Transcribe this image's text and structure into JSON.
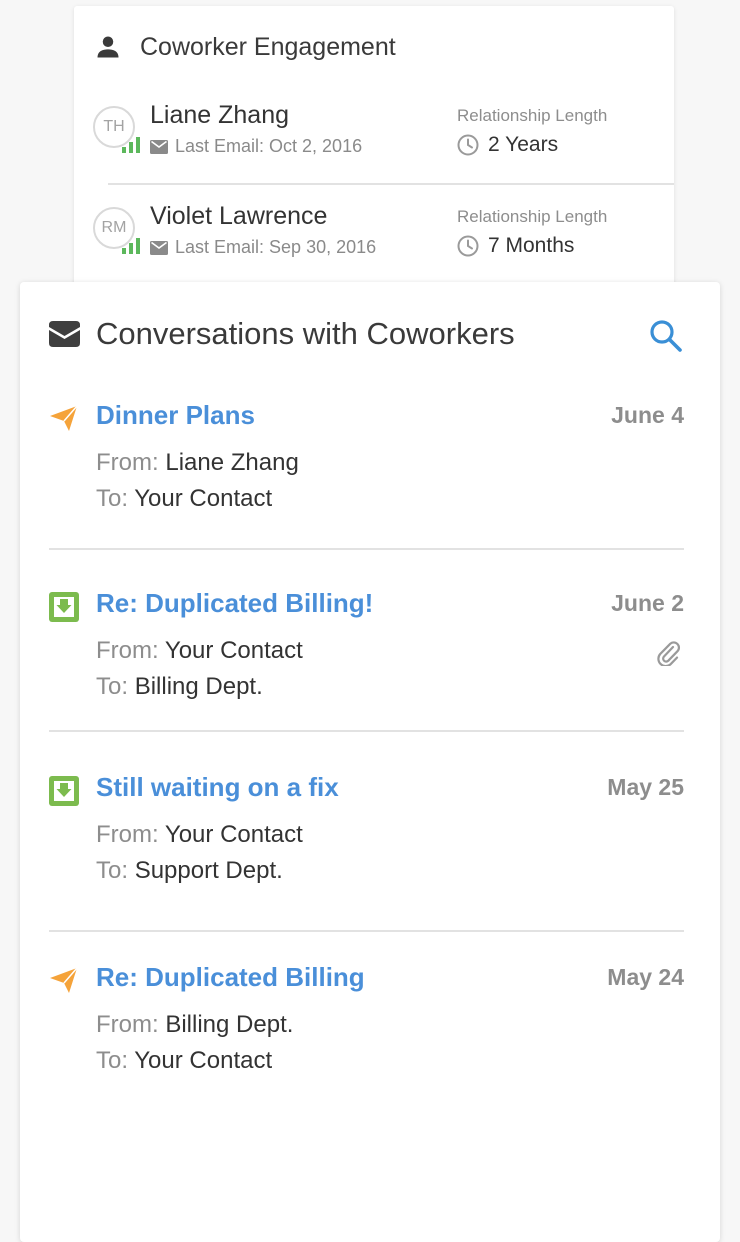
{
  "engagement": {
    "title": "Coworker Engagement",
    "icon": "person-icon",
    "contacts": [
      {
        "initials": "TH",
        "name": "Liane Zhang",
        "last_email": "Last Email: Oct 2, 2016",
        "relationship_label": "Relationship Length",
        "relationship_value": "2 Years"
      },
      {
        "initials": "RM",
        "name": "Violet Lawrence",
        "last_email": "Last Email: Sep 30, 2016",
        "relationship_label": "Relationship Length",
        "relationship_value": "7 Months"
      }
    ]
  },
  "conversations": {
    "title": "Conversations with Coworkers",
    "icon": "envelope-icon",
    "search_icon": "search-icon",
    "from_label": "From:",
    "to_label": "To:",
    "items": [
      {
        "type": "sent",
        "subject": "Dinner Plans",
        "date": "June 4",
        "from": "Liane Zhang",
        "to": "Your Contact",
        "attachment": false
      },
      {
        "type": "received",
        "subject": "Re: Duplicated Billing!",
        "date": "June 2",
        "from": "Your Contact",
        "to": "Billing Dept.",
        "attachment": true
      },
      {
        "type": "received",
        "subject": "Still waiting on a fix",
        "date": "May 25",
        "from": "Your Contact",
        "to": "Support Dept.",
        "attachment": false
      },
      {
        "type": "sent",
        "subject": "Re: Duplicated Billing",
        "date": "May 24",
        "from": "Billing Dept.",
        "to": "Your Contact",
        "attachment": false
      }
    ]
  },
  "colors": {
    "link_blue": "#4a8fd9",
    "sent_orange": "#f5a33a",
    "received_green": "#7cbb4e",
    "signal_green": "#5cb85c",
    "search_blue": "#3a8fd6"
  }
}
